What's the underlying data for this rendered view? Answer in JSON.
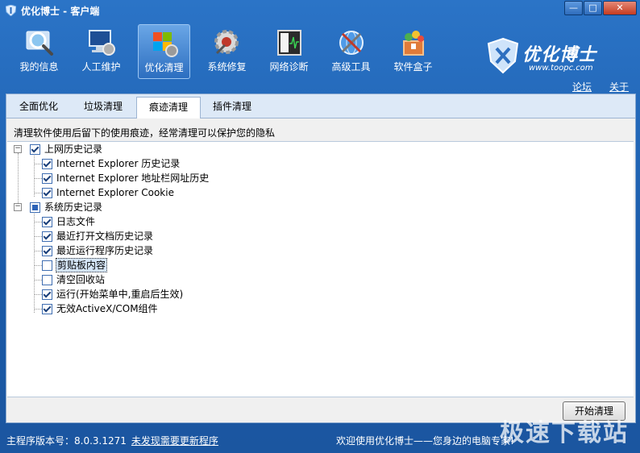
{
  "window": {
    "title": "优化博士 - 客户端",
    "buttons": {
      "minimize": "—",
      "maximize": "□",
      "close": "✕"
    }
  },
  "toolbar": {
    "items": [
      {
        "label": "我的信息",
        "icon": "magnifier-icon"
      },
      {
        "label": "人工维护",
        "icon": "computer-tools-icon"
      },
      {
        "label": "优化清理",
        "icon": "windows-gear-icon"
      },
      {
        "label": "系统修复",
        "icon": "gear-repair-icon"
      },
      {
        "label": "网络诊断",
        "icon": "network-monitor-icon"
      },
      {
        "label": "高级工具",
        "icon": "advanced-tools-icon"
      },
      {
        "label": "软件盒子",
        "icon": "software-box-icon"
      }
    ],
    "active_index": 2
  },
  "brand": {
    "name": "优化博士",
    "url": "www.toopc.com"
  },
  "toplinks": {
    "forum": "论坛",
    "about": "关于"
  },
  "tabs": [
    {
      "label": "全面优化"
    },
    {
      "label": "垃圾清理"
    },
    {
      "label": "痕迹清理"
    },
    {
      "label": "插件清理"
    }
  ],
  "active_tab": "痕迹清理",
  "description": "清理软件使用后留下的使用痕迹，经常清理可以保护您的隐私",
  "tree": {
    "groups": [
      {
        "label": "上网历史记录",
        "state": "checked",
        "items": [
          {
            "label": "Internet Explorer 历史记录",
            "checked": true
          },
          {
            "label": "Internet Explorer 地址栏网址历史",
            "checked": true
          },
          {
            "label": "Internet Explorer Cookie",
            "checked": true
          }
        ]
      },
      {
        "label": "系统历史记录",
        "state": "partial",
        "items": [
          {
            "label": "日志文件",
            "checked": true
          },
          {
            "label": "最近打开文档历史记录",
            "checked": true
          },
          {
            "label": "最近运行程序历史记录",
            "checked": true
          },
          {
            "label": "剪贴板内容",
            "checked": false,
            "selected": true
          },
          {
            "label": "清空回收站",
            "checked": false
          },
          {
            "label": "运行(开始菜单中,重启后生效)",
            "checked": true
          },
          {
            "label": "无效ActiveX/COM组件",
            "checked": true
          }
        ]
      }
    ]
  },
  "start_button": "开始清理",
  "status": {
    "version_label": "主程序版本号：",
    "version": "8.0.3.1271",
    "update_link": "未发现需要更新程序",
    "welcome": "欢迎使用优化博士——您身边的电脑专家!"
  },
  "watermark": "极速下载站",
  "colors": {
    "accent": "#1a5aa8",
    "panel": "#f0f0f0",
    "tab_bar": "#dde9f7"
  }
}
